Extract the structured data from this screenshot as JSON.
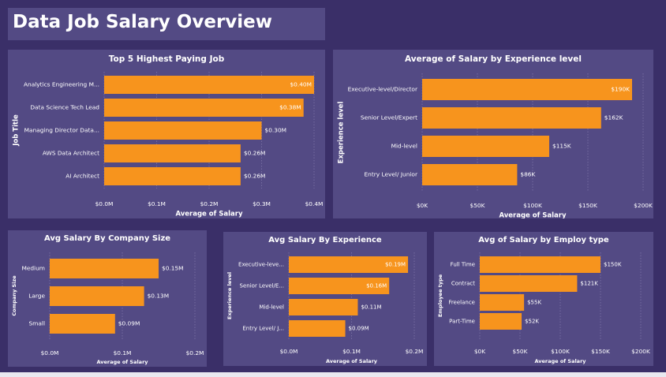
{
  "page": {
    "title": "Data Job Salary Overview"
  },
  "colors": {
    "background": "#3a2f68",
    "panel": "#534a84",
    "bar": "#f7941d",
    "text": "#ffffff"
  },
  "chart_data": [
    {
      "type": "bar",
      "orientation": "horizontal",
      "title": "Top 5 Highest Paying Job",
      "xlabel": "Average of Salary",
      "ylabel": "Job Title",
      "categories": [
        "Analytics Engineering M...",
        "Data Science Tech Lead",
        "Managing Director Data...",
        "AWS Data Architect",
        "AI Architect"
      ],
      "values": [
        0.4,
        0.38,
        0.3,
        0.26,
        0.26
      ],
      "data_labels": [
        "$0.40M",
        "$0.38M",
        "$0.30M",
        "$0.26M",
        "$0.26M"
      ],
      "xticks": [
        0,
        0.1,
        0.2,
        0.3,
        0.4
      ],
      "xtick_labels": [
        "$0.0M",
        "$0.1M",
        "$0.2M",
        "$0.3M",
        "$0.4M"
      ],
      "xlim": [
        0,
        0.4
      ],
      "grid": true
    },
    {
      "type": "bar",
      "orientation": "horizontal",
      "title": "Average of Salary by Experience level",
      "xlabel": "Average of Salary",
      "ylabel": "Experience level",
      "categories": [
        "Executive-level/Director",
        "Senior Level/Expert",
        "Mid-level",
        "Entry Level/ Junior"
      ],
      "values": [
        190,
        162,
        115,
        86
      ],
      "data_labels": [
        "$190K",
        "$162K",
        "$115K",
        "$86K"
      ],
      "xticks": [
        0,
        50,
        100,
        150,
        200
      ],
      "xtick_labels": [
        "$0K",
        "$50K",
        "$100K",
        "$150K",
        "$200K"
      ],
      "xlim": [
        0,
        200
      ],
      "grid": true
    },
    {
      "type": "bar",
      "orientation": "horizontal",
      "title": "Avg Salary By Company Size",
      "xlabel": "Average of Salary",
      "ylabel": "Company Size",
      "categories": [
        "Medium",
        "Large",
        "Small"
      ],
      "values": [
        0.15,
        0.13,
        0.09
      ],
      "data_labels": [
        "$0.15M",
        "$0.13M",
        "$0.09M"
      ],
      "xticks": [
        0,
        0.1,
        0.2
      ],
      "xtick_labels": [
        "$0.0M",
        "$0.1M",
        "$0.2M"
      ],
      "xlim": [
        0,
        0.2
      ],
      "grid": true
    },
    {
      "type": "bar",
      "orientation": "horizontal",
      "title": "Avg Salary By Experience",
      "xlabel": "Average of Salary",
      "ylabel": "Experience level",
      "categories": [
        "Executive-leve...",
        "Senior Level/E...",
        "Mid-level",
        "Entry Level/ J..."
      ],
      "values": [
        0.19,
        0.16,
        0.11,
        0.09
      ],
      "data_labels": [
        "$0.19M",
        "$0.16M",
        "$0.11M",
        "$0.09M"
      ],
      "xticks": [
        0,
        0.1,
        0.2
      ],
      "xtick_labels": [
        "$0.0M",
        "$0.1M",
        "$0.2M"
      ],
      "xlim": [
        0,
        0.2
      ],
      "grid": true
    },
    {
      "type": "bar",
      "orientation": "horizontal",
      "title": "Avg of Salary by Employ type",
      "xlabel": "Average of Salary",
      "ylabel": "Employee type",
      "categories": [
        "Full Time",
        "Contract",
        "Freelance",
        "Part-Time"
      ],
      "values": [
        150,
        121,
        55,
        52
      ],
      "data_labels": [
        "$150K",
        "$121K",
        "$55K",
        "$52K"
      ],
      "xticks": [
        0,
        50,
        100,
        150,
        200
      ],
      "xtick_labels": [
        "$0K",
        "$50K",
        "$100K",
        "$150K",
        "$200K"
      ],
      "xlim": [
        0,
        200
      ],
      "grid": true
    }
  ]
}
